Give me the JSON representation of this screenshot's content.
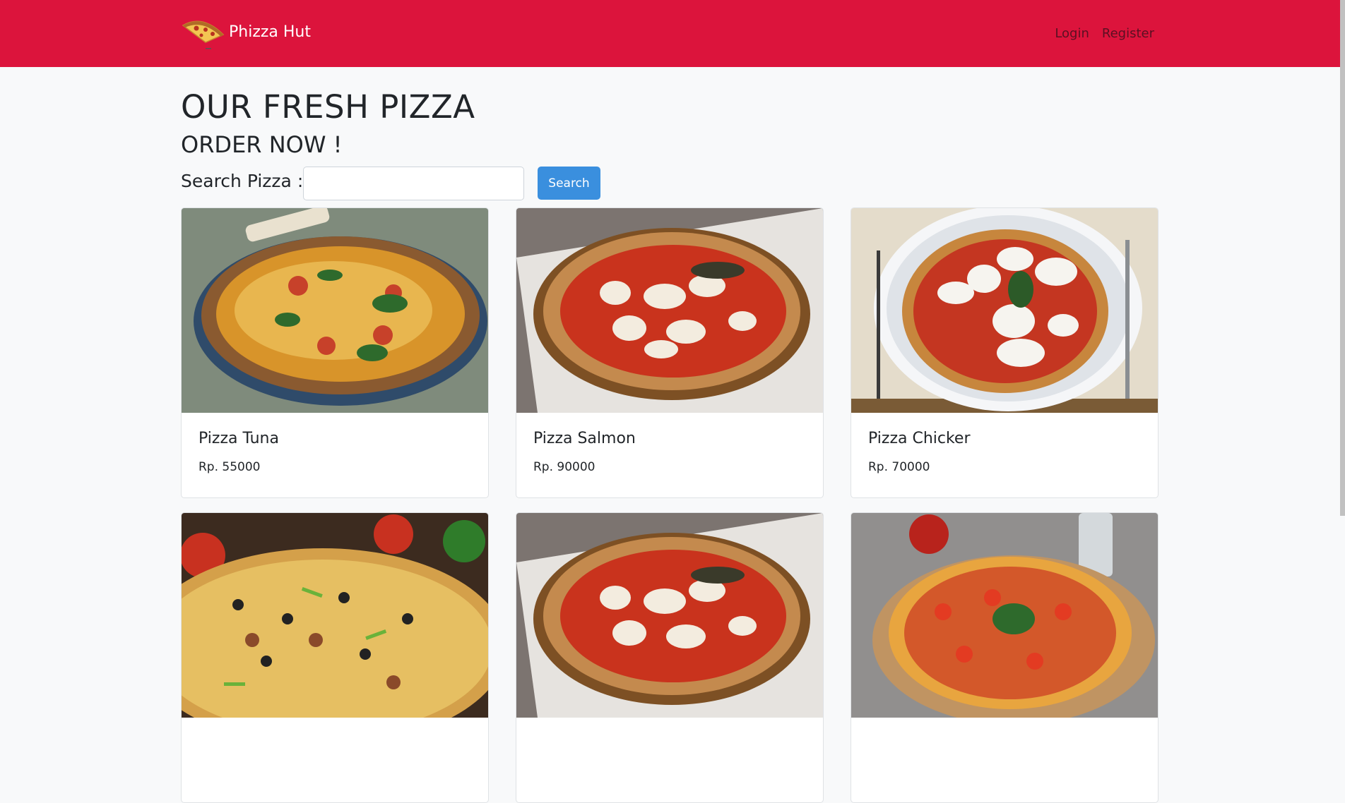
{
  "navbar": {
    "brand": "Phizza Hut",
    "logo_icon": "pizza-slice-icon",
    "links": [
      "Login",
      "Register"
    ],
    "background_color": "#dc143c"
  },
  "main": {
    "title": "OUR FRESH PIZZA",
    "subtitle": "ORDER NOW !",
    "search": {
      "label": "Search Pizza :",
      "value": "",
      "placeholder": "",
      "button_label": "Search",
      "button_color": "#3a8fde"
    }
  },
  "pizzas": [
    {
      "name": "Pizza Tuna",
      "price": "Rp. 55000"
    },
    {
      "name": "Pizza Salmon",
      "price": "Rp. 90000"
    },
    {
      "name": "Pizza Chicker",
      "price": "Rp. 70000"
    }
  ]
}
